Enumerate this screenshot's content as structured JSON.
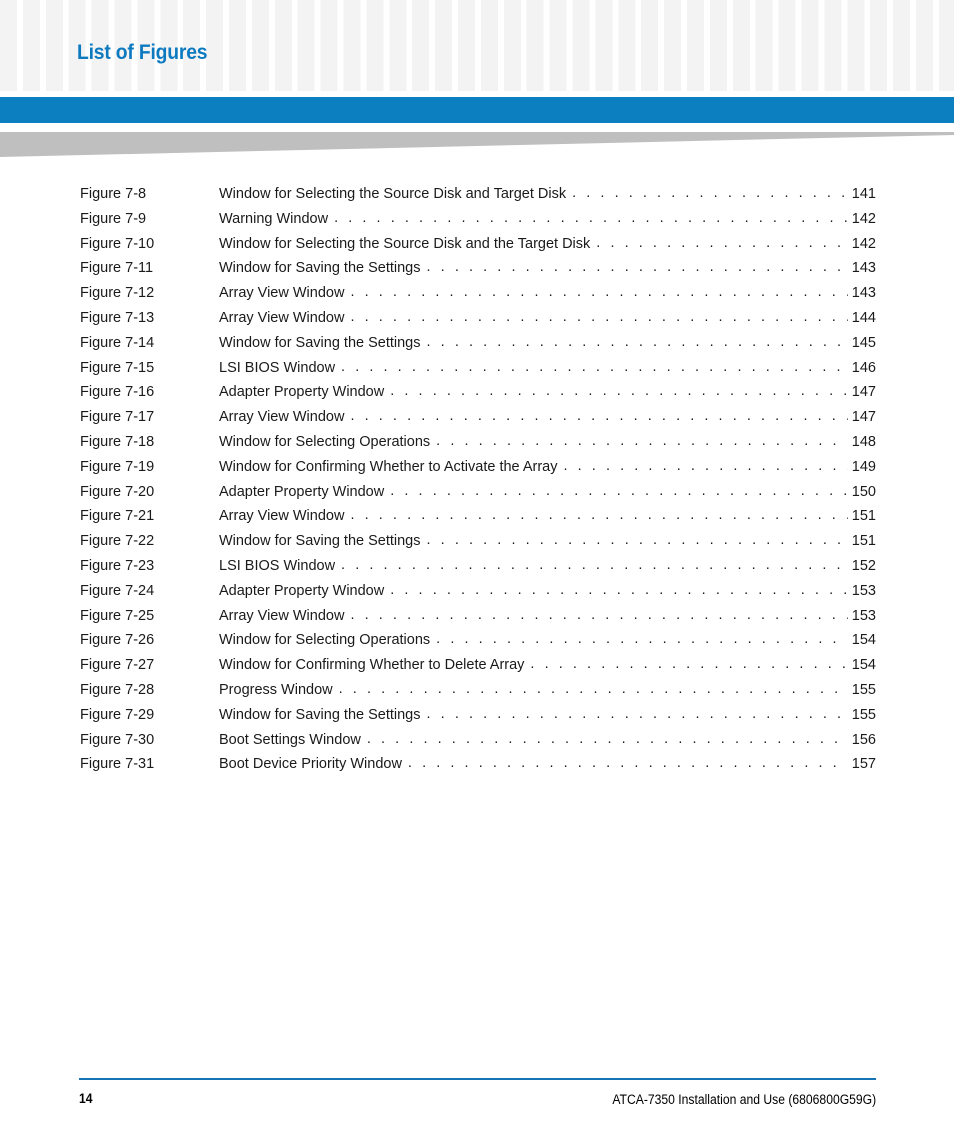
{
  "header": {
    "title": "List of Figures",
    "accent_color": "#0b7fc0",
    "title_color": "#0d7ac0",
    "wedge_color": "#bfbfbf",
    "grid_square_color": "#f3f3f3"
  },
  "toc": {
    "leader_dots": ". . . . . . . . . . . . . . . . . . . . . . . . . . . . . . . . . . . . . . . . . . . . . . . . . . . . . . . . . . . . . . . . . . . . . . . . . . . . . . . . . . . . . . . . . . . . . . . . . .",
    "entries": [
      {
        "label": "Figure 7-8",
        "title": "Window for Selecting the Source Disk and Target Disk",
        "page": "141"
      },
      {
        "label": "Figure 7-9",
        "title": "Warning Window",
        "page": "142"
      },
      {
        "label": "Figure 7-10",
        "title": "Window for Selecting the Source Disk and the Target Disk",
        "page": "142"
      },
      {
        "label": "Figure 7-11",
        "title": "Window for Saving the Settings",
        "page": "143"
      },
      {
        "label": "Figure 7-12",
        "title": "Array View Window",
        "page": "143"
      },
      {
        "label": "Figure 7-13",
        "title": "Array View Window",
        "page": "144"
      },
      {
        "label": "Figure 7-14",
        "title": "Window for Saving the Settings",
        "page": "145"
      },
      {
        "label": "Figure 7-15",
        "title": "LSI BIOS Window",
        "page": "146"
      },
      {
        "label": "Figure 7-16",
        "title": "Adapter Property Window",
        "page": "147"
      },
      {
        "label": "Figure 7-17",
        "title": "Array View Window",
        "page": "147"
      },
      {
        "label": "Figure 7-18",
        "title": "Window for Selecting Operations",
        "page": "148"
      },
      {
        "label": "Figure 7-19",
        "title": "Window for Confirming Whether to Activate the Array",
        "page": "149"
      },
      {
        "label": "Figure 7-20",
        "title": "Adapter Property Window",
        "page": "150"
      },
      {
        "label": "Figure 7-21",
        "title": "Array View Window",
        "page": "151"
      },
      {
        "label": "Figure 7-22",
        "title": "Window for Saving the Settings",
        "page": "151"
      },
      {
        "label": "Figure 7-23",
        "title": "LSI BIOS Window",
        "page": "152"
      },
      {
        "label": "Figure 7-24",
        "title": "Adapter Property Window",
        "page": "153"
      },
      {
        "label": "Figure 7-25",
        "title": "Array View Window",
        "page": "153"
      },
      {
        "label": "Figure 7-26",
        "title": "Window for Selecting Operations",
        "page": "154"
      },
      {
        "label": "Figure 7-27",
        "title": "Window for Confirming Whether to Delete Array",
        "page": "154"
      },
      {
        "label": "Figure 7-28",
        "title": "Progress Window",
        "page": "155"
      },
      {
        "label": "Figure 7-29",
        "title": "Window for Saving the Settings",
        "page": "155"
      },
      {
        "label": "Figure 7-30",
        "title": "Boot Settings Window",
        "page": "156"
      },
      {
        "label": "Figure 7-31",
        "title": "Boot Device Priority Window",
        "page": "157"
      }
    ]
  },
  "footer": {
    "page_number": "14",
    "document_title": "ATCA-7350 Installation and Use (6806800G59G)",
    "rule_color": "#1574b5"
  }
}
